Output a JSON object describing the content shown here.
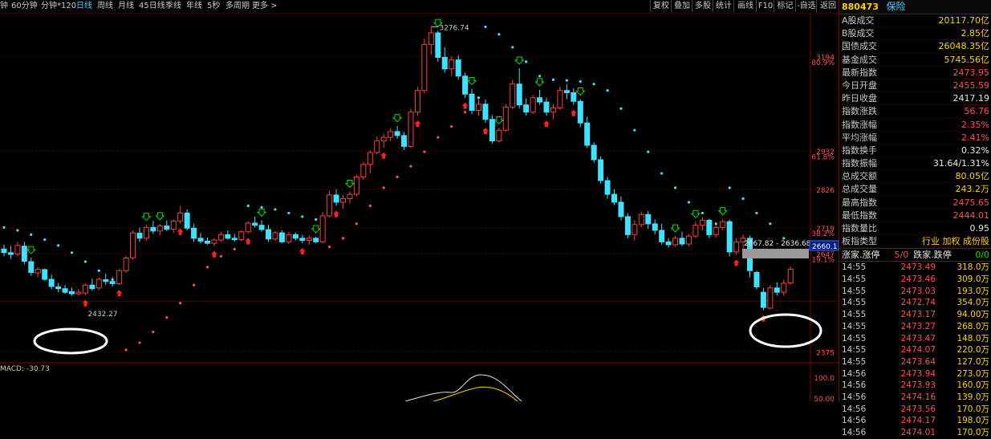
{
  "toolbar": {
    "periods": [
      "钟",
      "60分钟",
      "分钟*120",
      "日线",
      "周线",
      "月线",
      "45日线",
      "季线",
      "年线",
      "5秒",
      "多周期",
      "更多 >"
    ],
    "active_index": 3,
    "buttons": [
      "复权",
      "叠加",
      "多股",
      "统计",
      "画线",
      "F10",
      "标记",
      "-自选",
      "返回"
    ]
  },
  "panel": {
    "code": "880473",
    "name": "保险",
    "stats": [
      {
        "label": "A股成交",
        "value": "20117.70亿",
        "color": "yellow"
      },
      {
        "label": "B股成交",
        "value": "2.85亿",
        "color": "yellow"
      },
      {
        "label": "国债成交",
        "value": "26048.35亿",
        "color": "yellow"
      },
      {
        "label": "基金成交",
        "value": "5745.56亿",
        "color": "yellow"
      },
      {
        "label": "最新指数",
        "value": "2473.95",
        "color": "red"
      },
      {
        "label": "今日开盘",
        "value": "2455.59",
        "color": "red"
      },
      {
        "label": "昨日收盘",
        "value": "2417.19",
        "color": "white"
      },
      {
        "label": "指数涨跌",
        "value": "56.76",
        "color": "red"
      },
      {
        "label": "指数涨幅",
        "value": "2.35%",
        "color": "red"
      },
      {
        "label": "平均涨幅",
        "value": "2.41%",
        "color": "red"
      },
      {
        "label": "指数换手",
        "value": "0.32%",
        "color": "white"
      },
      {
        "label": "指数振幅",
        "value": "31.64/1.31%",
        "color": "white"
      },
      {
        "label": "总成交额",
        "value": "80.05亿",
        "color": "yellow"
      },
      {
        "label": "总成交量",
        "value": "243.2万",
        "color": "yellow"
      },
      {
        "label": "最高指数",
        "value": "2475.65",
        "color": "red"
      },
      {
        "label": "最低指数",
        "value": "2444.01",
        "color": "red"
      },
      {
        "label": "指数量比",
        "value": "0.95",
        "color": "white"
      }
    ],
    "type_row": {
      "label": "板指类型",
      "value": "行业 加权 成份股"
    },
    "limit_row": {
      "label1": "涨家.涨停",
      "value1": "5/0",
      "label2": "跌家.跌停",
      "value2": "0/0"
    },
    "ticks": [
      {
        "time": "14:55",
        "price": "2473.49",
        "vol": "318.0万"
      },
      {
        "time": "14:55",
        "price": "2473.46",
        "vol": "309.0万"
      },
      {
        "time": "14:55",
        "price": "2473.03",
        "vol": "193.0万"
      },
      {
        "time": "14:55",
        "price": "2472.74",
        "vol": "354.0万"
      },
      {
        "time": "14:55",
        "price": "2473.17",
        "vol": "94.00万"
      },
      {
        "time": "14:55",
        "price": "2473.27",
        "vol": "268.0万"
      },
      {
        "time": "14:55",
        "price": "2473.47",
        "vol": "148.0万"
      },
      {
        "time": "14:55",
        "price": "2474.07",
        "vol": "220.0万"
      },
      {
        "time": "14:55",
        "price": "2473.64",
        "vol": "127.0万"
      },
      {
        "time": "14:56",
        "price": "2473.94",
        "vol": "273.0万"
      },
      {
        "time": "14:56",
        "price": "2473.93",
        "vol": "160.0万"
      },
      {
        "time": "14:56",
        "price": "2474.16",
        "vol": "139.0万"
      },
      {
        "time": "14:56",
        "price": "2473.56",
        "vol": "170.0万"
      },
      {
        "time": "14:56",
        "price": "2474.17",
        "vol": "198.0万"
      },
      {
        "time": "14:56",
        "price": "2474.01",
        "vol": "170.0万"
      }
    ]
  },
  "chart_data": {
    "type": "candlestick",
    "ylim": [
      2360,
      3300
    ],
    "y_ticks": [
      "3194",
      "2932",
      "2826",
      "2719",
      "2647",
      "2375"
    ],
    "pct_ticks": [
      "80.9%",
      "61.8%",
      "38.2%",
      "19.1%"
    ],
    "high_label": "3276.74",
    "low_label": "2432.27",
    "range_label": "2667.82 - 2636.68",
    "current_price_label": "2660.1",
    "macd_label": "MACD: -30.73",
    "macd_ticks": [
      "100.0",
      "50.00"
    ],
    "ohlc": [
      [
        2660,
        2672,
        2640,
        2650
      ],
      [
        2650,
        2668,
        2632,
        2645
      ],
      [
        2646,
        2680,
        2640,
        2670
      ],
      [
        2668,
        2680,
        2618,
        2626
      ],
      [
        2625,
        2636,
        2586,
        2595
      ],
      [
        2594,
        2610,
        2582,
        2604
      ],
      [
        2603,
        2606,
        2572,
        2576
      ],
      [
        2576,
        2590,
        2548,
        2556
      ],
      [
        2555,
        2566,
        2540,
        2550
      ],
      [
        2550,
        2560,
        2536,
        2540
      ],
      [
        2542,
        2553,
        2530,
        2536
      ],
      [
        2536,
        2549,
        2530,
        2540
      ],
      [
        2538,
        2564,
        2532,
        2560
      ],
      [
        2560,
        2578,
        2544,
        2550
      ],
      [
        2552,
        2582,
        2546,
        2576
      ],
      [
        2575,
        2592,
        2560,
        2570
      ],
      [
        2570,
        2582,
        2556,
        2564
      ],
      [
        2564,
        2605,
        2560,
        2600
      ],
      [
        2600,
        2642,
        2594,
        2635
      ],
      [
        2636,
        2712,
        2630,
        2705
      ],
      [
        2704,
        2720,
        2680,
        2690
      ],
      [
        2690,
        2728,
        2682,
        2720
      ],
      [
        2720,
        2738,
        2702,
        2710
      ],
      [
        2710,
        2730,
        2698,
        2724
      ],
      [
        2724,
        2740,
        2710,
        2715
      ],
      [
        2715,
        2742,
        2705,
        2738
      ],
      [
        2738,
        2780,
        2730,
        2760
      ],
      [
        2760,
        2770,
        2712,
        2718
      ],
      [
        2718,
        2730,
        2680,
        2690
      ],
      [
        2690,
        2705,
        2676,
        2682
      ],
      [
        2682,
        2692,
        2672,
        2676
      ],
      [
        2676,
        2690,
        2668,
        2685
      ],
      [
        2685,
        2708,
        2680,
        2700
      ],
      [
        2700,
        2712,
        2686,
        2690
      ],
      [
        2690,
        2702,
        2680,
        2686
      ],
      [
        2686,
        2712,
        2682,
        2708
      ],
      [
        2708,
        2738,
        2704,
        2732
      ],
      [
        2732,
        2750,
        2720,
        2726
      ],
      [
        2726,
        2740,
        2708,
        2714
      ],
      [
        2714,
        2728,
        2680,
        2688
      ],
      [
        2688,
        2710,
        2682,
        2705
      ],
      [
        2705,
        2712,
        2676,
        2680
      ],
      [
        2680,
        2708,
        2674,
        2700
      ],
      [
        2700,
        2706,
        2684,
        2690
      ],
      [
        2690,
        2700,
        2676,
        2684
      ],
      [
        2684,
        2698,
        2672,
        2690
      ],
      [
        2690,
        2694,
        2676,
        2680
      ],
      [
        2680,
        2762,
        2676,
        2752
      ],
      [
        2752,
        2822,
        2748,
        2810
      ],
      [
        2810,
        2826,
        2780,
        2790
      ],
      [
        2790,
        2810,
        2772,
        2800
      ],
      [
        2800,
        2820,
        2786,
        2812
      ],
      [
        2812,
        2866,
        2806,
        2860
      ],
      [
        2860,
        2902,
        2852,
        2895
      ],
      [
        2895,
        2935,
        2870,
        2928
      ],
      [
        2928,
        2972,
        2922,
        2960
      ],
      [
        2960,
        2980,
        2942,
        2970
      ],
      [
        2970,
        2996,
        2960,
        2986
      ],
      [
        2986,
        3002,
        2966,
        2975
      ],
      [
        2975,
        2985,
        2935,
        2945
      ],
      [
        2945,
        3050,
        2940,
        3040
      ],
      [
        3040,
        3110,
        3030,
        3100
      ],
      [
        3100,
        3244,
        3092,
        3228
      ],
      [
        3228,
        3277,
        3200,
        3260
      ],
      [
        3260,
        3266,
        3180,
        3192
      ],
      [
        3192,
        3220,
        3150,
        3160
      ],
      [
        3160,
        3195,
        3140,
        3185
      ],
      [
        3185,
        3198,
        3130,
        3140
      ],
      [
        3140,
        3150,
        3080,
        3090
      ],
      [
        3090,
        3105,
        3034,
        3045
      ],
      [
        3045,
        3075,
        3030,
        3062
      ],
      [
        3062,
        3075,
        3010,
        3020
      ],
      [
        3020,
        3032,
        2952,
        2960
      ],
      [
        2960,
        2996,
        2955,
        2990
      ],
      [
        2990,
        3062,
        2985,
        3054
      ],
      [
        3054,
        3130,
        3048,
        3118
      ],
      [
        3118,
        3162,
        3050,
        3060
      ],
      [
        3060,
        3078,
        3030,
        3040
      ],
      [
        3040,
        3088,
        3035,
        3080
      ],
      [
        3080,
        3102,
        3060,
        3068
      ],
      [
        3068,
        3080,
        3030,
        3040
      ],
      [
        3040,
        3062,
        3020,
        3052
      ],
      [
        3052,
        3112,
        3046,
        3100
      ],
      [
        3100,
        3118,
        3076,
        3094
      ],
      [
        3094,
        3106,
        3060,
        3070
      ],
      [
        3070,
        3076,
        2998,
        3010
      ],
      [
        3010,
        3028,
        2940,
        2948
      ],
      [
        2948,
        2956,
        2900,
        2908
      ],
      [
        2908,
        2918,
        2842,
        2850
      ],
      [
        2850,
        2860,
        2800,
        2812
      ],
      [
        2812,
        2826,
        2782,
        2790
      ],
      [
        2790,
        2806,
        2740,
        2750
      ],
      [
        2750,
        2760,
        2690,
        2700
      ],
      [
        2700,
        2740,
        2684,
        2728
      ],
      [
        2728,
        2764,
        2720,
        2756
      ],
      [
        2756,
        2766,
        2716,
        2730
      ],
      [
        2730,
        2742,
        2700,
        2712
      ],
      [
        2712,
        2730,
        2672,
        2680
      ],
      [
        2680,
        2690,
        2664,
        2672
      ],
      [
        2672,
        2696,
        2666,
        2690
      ],
      [
        2690,
        2708,
        2668,
        2674
      ],
      [
        2674,
        2702,
        2668,
        2696
      ],
      [
        2696,
        2736,
        2690,
        2726
      ],
      [
        2726,
        2748,
        2712,
        2740
      ],
      [
        2740,
        2744,
        2690,
        2700
      ],
      [
        2700,
        2728,
        2692,
        2720
      ],
      [
        2720,
        2744,
        2712,
        2736
      ],
      [
        2736,
        2742,
        2640,
        2652
      ],
      [
        2652,
        2690,
        2644,
        2680
      ],
      [
        2680,
        2700,
        2660,
        2690
      ],
      [
        2690,
        2698,
        2582,
        2600
      ],
      [
        2595,
        2600,
        2548,
        2555
      ],
      [
        2540,
        2552,
        2490,
        2498
      ],
      [
        2496,
        2560,
        2492,
        2552
      ],
      [
        2552,
        2568,
        2530,
        2540
      ],
      [
        2540,
        2575,
        2530,
        2565
      ],
      [
        2566,
        2612,
        2560,
        2604
      ]
    ],
    "sar": [
      [
        0,
        2720
      ],
      [
        2,
        2712
      ],
      [
        4,
        2700
      ],
      [
        6,
        2686
      ],
      [
        8,
        2670
      ],
      [
        10,
        2650
      ],
      [
        12,
        2625
      ],
      [
        14,
        2600
      ],
      [
        16,
        2575
      ],
      [
        18,
        2380
      ],
      [
        20,
        2400
      ],
      [
        22,
        2430
      ],
      [
        24,
        2470
      ],
      [
        26,
        2510
      ],
      [
        28,
        2560
      ],
      [
        30,
        2610
      ],
      [
        32,
        2640
      ],
      [
        34,
        2660
      ],
      [
        36,
        2780
      ],
      [
        38,
        2776
      ],
      [
        40,
        2770
      ],
      [
        42,
        2760
      ],
      [
        44,
        2750
      ],
      [
        46,
        2742
      ],
      [
        48,
        2666
      ],
      [
        50,
        2690
      ],
      [
        52,
        2730
      ],
      [
        54,
        2780
      ],
      [
        56,
        2830
      ],
      [
        58,
        2860
      ],
      [
        60,
        2890
      ],
      [
        62,
        2930
      ],
      [
        64,
        2970
      ],
      [
        66,
        3000
      ],
      [
        68,
        3040
      ],
      [
        70,
        3080
      ],
      [
        71,
        3277
      ],
      [
        73,
        3256
      ],
      [
        75,
        3220
      ],
      [
        77,
        3180
      ],
      [
        79,
        3140
      ],
      [
        81,
        3130
      ],
      [
        83,
        3128
      ],
      [
        85,
        3125
      ],
      [
        87,
        3118
      ],
      [
        89,
        3100
      ],
      [
        91,
        3050
      ],
      [
        93,
        2990
      ],
      [
        95,
        2930
      ],
      [
        97,
        2870
      ],
      [
        99,
        2830
      ],
      [
        101,
        2790
      ],
      [
        103,
        2760
      ],
      [
        105,
        2730
      ],
      [
        107,
        2830
      ],
      [
        109,
        2800
      ],
      [
        111,
        2760
      ],
      [
        113,
        2730
      ],
      [
        115,
        2690
      ]
    ]
  }
}
